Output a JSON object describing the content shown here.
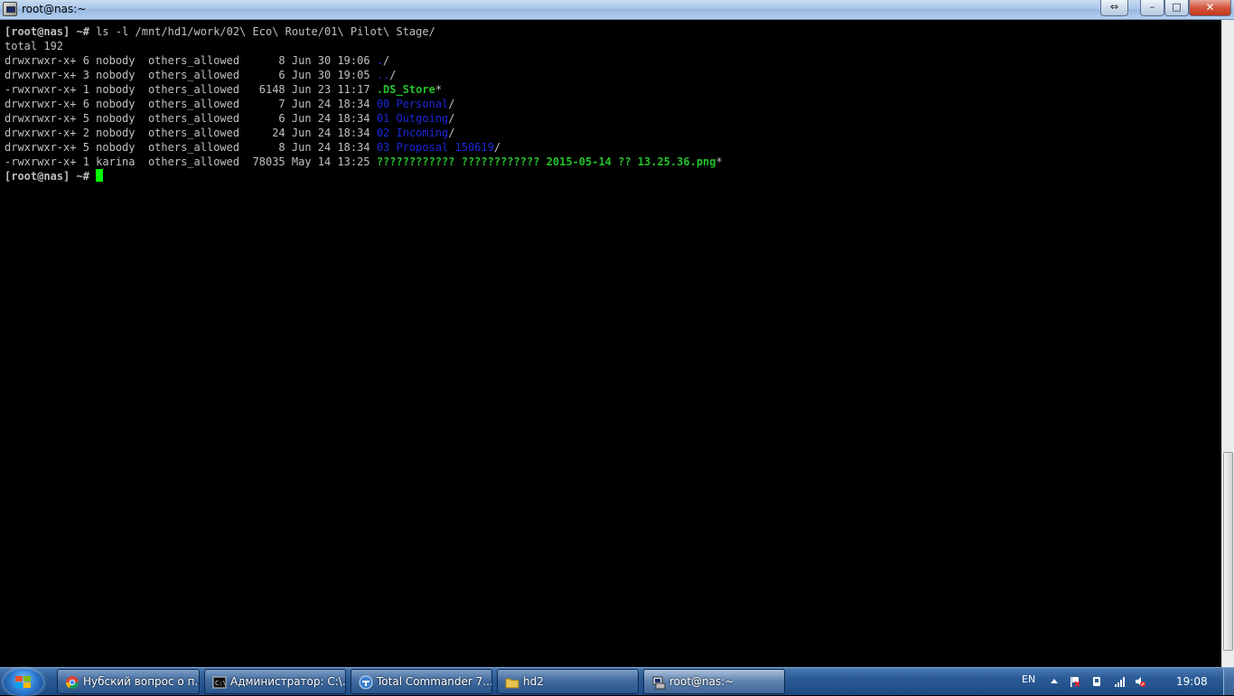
{
  "window": {
    "title": "root@nas:~",
    "background_tabs": [
      "",
      "",
      "",
      "",
      ""
    ],
    "buttons": {
      "resize": "⇔",
      "minimize": "–",
      "maximize": "□",
      "close": "✕"
    }
  },
  "terminal": {
    "command_line": {
      "prompt": "[root@nas] ~#",
      "command": " ls -l /mnt/hd1/work/02\\ Eco\\ Route/01\\ Pilot\\ Stage/"
    },
    "total": "total 192",
    "listing": [
      {
        "meta": "drwxrwxr-x+ 6 nobody  others_allowed      8 Jun 30 19:06 ",
        "name": ".",
        "suffix": "/",
        "color": "blue"
      },
      {
        "meta": "drwxrwxr-x+ 3 nobody  others_allowed      6 Jun 30 19:05 ",
        "name": "..",
        "suffix": "/",
        "color": "blue"
      },
      {
        "meta": "-rwxrwxr-x+ 1 nobody  others_allowed   6148 Jun 23 11:17 ",
        "name": ".DS_Store",
        "suffix": "*",
        "color": "green"
      },
      {
        "meta": "drwxrwxr-x+ 6 nobody  others_allowed      7 Jun 24 18:34 ",
        "name": "00 Personal",
        "suffix": "/",
        "color": "blue"
      },
      {
        "meta": "drwxrwxr-x+ 5 nobody  others_allowed      6 Jun 24 18:34 ",
        "name": "01 Outgoing",
        "suffix": "/",
        "color": "blue"
      },
      {
        "meta": "drwxrwxr-x+ 2 nobody  others_allowed     24 Jun 24 18:34 ",
        "name": "02 Incoming",
        "suffix": "/",
        "color": "blue"
      },
      {
        "meta": "drwxrwxr-x+ 5 nobody  others_allowed      8 Jun 24 18:34 ",
        "name": "03 Proposal 150619",
        "suffix": "/",
        "color": "blue"
      },
      {
        "meta": "-rwxrwxr-x+ 1 karina  others_allowed  78035 May 14 13:25 ",
        "name": "???????????? ???????????? 2015-05-14 ?? 13.25.36.png",
        "suffix": "*",
        "color": "green"
      }
    ],
    "final_prompt": "[root@nas] ~#"
  },
  "taskbar": {
    "items": [
      {
        "label": "Нубский вопрос о п...",
        "icon": "chrome-icon"
      },
      {
        "label": "Администратор: C:\\...",
        "icon": "cmd-icon"
      },
      {
        "label": "Total Commander 7....",
        "icon": "total-commander-icon"
      },
      {
        "label": "hd2",
        "icon": "folder-icon"
      },
      {
        "label": "root@nas:~",
        "icon": "putty-icon"
      }
    ],
    "tray": {
      "language": "EN",
      "clock": "19:08"
    }
  }
}
